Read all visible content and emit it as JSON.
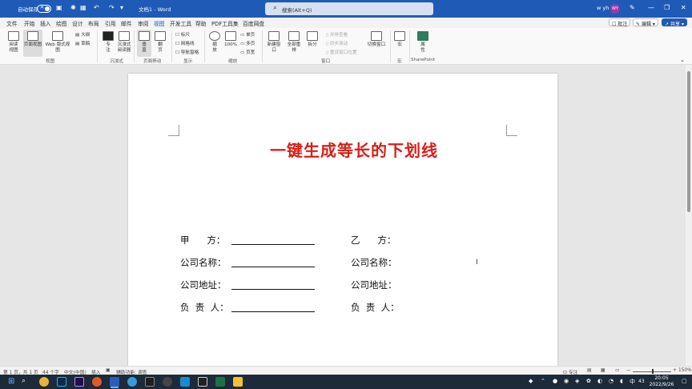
{
  "titlebar": {
    "autosave_label": "自动保存",
    "autosave_state": "关",
    "doc_title": "文档1 - Word",
    "search_placeholder": "搜索(Alt+Q)",
    "user_name": "w yh",
    "avatar_initials": "WY",
    "accent_color": "#1f5bb6"
  },
  "menu": {
    "items": [
      "文件",
      "开始",
      "插入",
      "绘图",
      "设计",
      "布局",
      "引用",
      "邮件",
      "审阅",
      "视图",
      "开发工具",
      "帮助",
      "PDF工具集",
      "百度网盘"
    ],
    "active": "视图",
    "comment_label": "批注",
    "edit_label": "编辑",
    "share_label": "共享"
  },
  "ribbon": {
    "views": {
      "read": "阅读\n视图",
      "print": "页面视图",
      "web": "Web 版式视图",
      "outline": "大纲",
      "draft": "草稿",
      "group": "视图"
    },
    "immersive": {
      "focus": "专\n注",
      "reader": "沉浸式\n阅读器",
      "group": "沉浸式"
    },
    "page_move": {
      "vertical": "垂\n直",
      "side": "翻\n页",
      "group": "页面移动"
    },
    "show": {
      "ruler": "标尺",
      "gridlines": "网格线",
      "nav_pane": "导航窗格",
      "group": "显示"
    },
    "zoom": {
      "zoom": "缩\n放",
      "hundred": "100%",
      "one_page": "单页",
      "multi_page": "多页",
      "page_width": "页宽",
      "group": "缩放"
    },
    "window": {
      "new": "新建窗口",
      "arrange": "全部重排",
      "split": "拆分",
      "side_by_side": "并排查看",
      "sync_scroll": "同步滚动",
      "reset_pos": "重设窗口位置",
      "switch": "切换窗口",
      "group": "窗口"
    },
    "macro": {
      "macro": "宏",
      "group": "宏"
    },
    "sharepoint": {
      "props": "属\n性",
      "group": "SharePoint"
    }
  },
  "document": {
    "title": "一键生成等长的下划线",
    "rows": [
      {
        "left": "甲      方：",
        "right": "乙      方："
      },
      {
        "left": "公司名称：",
        "right": "公司名称："
      },
      {
        "left": "公司地址：",
        "right": "公司地址："
      },
      {
        "left": "负  责  人：",
        "right": "负  责  人："
      }
    ],
    "title_color": "#d91e18"
  },
  "statusbar": {
    "page": "第 1 页，共 1 页",
    "words": "44 个字",
    "language": "中文(中国)",
    "insert_mode": "插入",
    "accessibility": "辅助功能: 调查",
    "focus": "专注",
    "zoom": "150%"
  },
  "taskbar": {
    "time": "20:05",
    "date": "2022/9/26",
    "notif_count": "43"
  }
}
